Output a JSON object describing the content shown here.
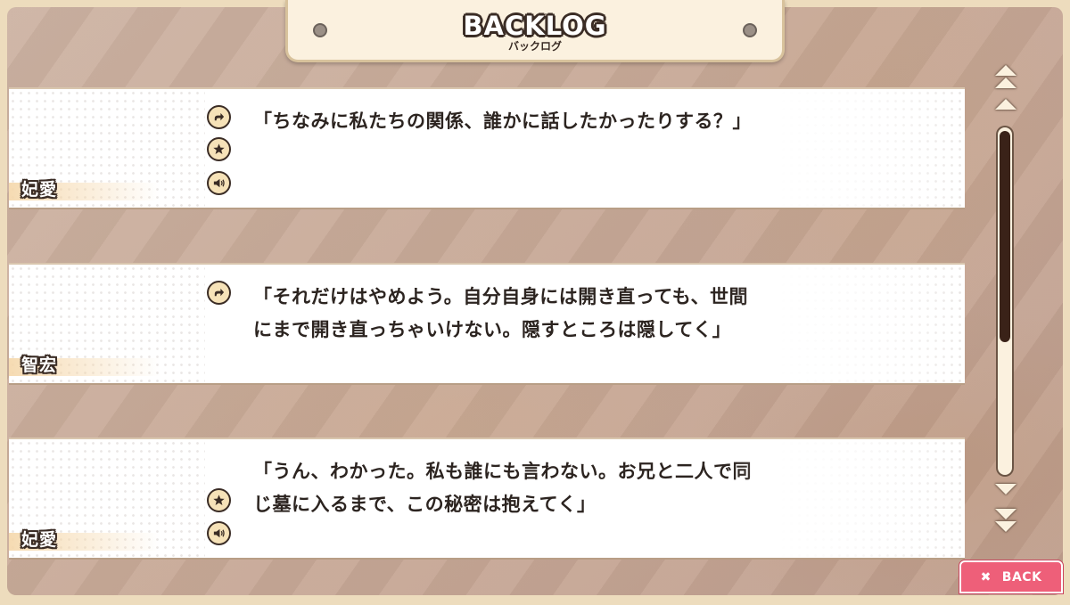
{
  "header": {
    "title": "BACKLOG",
    "subtitle": "バックログ"
  },
  "entries": [
    {
      "speaker": "妃愛",
      "text": "「ちなみに私たちの関係、誰かに話したかったりする？」",
      "icons": [
        "jump-icon",
        "star-icon",
        "voice-icon"
      ]
    },
    {
      "speaker": "智宏",
      "text": "「それだけはやめよう。自分自身には開き直っても、世間\nにまで開き直っちゃいけない。隠すところは隠してく」",
      "icons": [
        "jump-icon"
      ]
    },
    {
      "speaker": "妃愛",
      "text": "「うん、わかった。私も誰にも言わない。お兄と二人で同\nじ墓に入るまで、この秘密は抱えてく」",
      "icons": [
        "star-icon",
        "voice-icon"
      ]
    }
  ],
  "scrollbar": {
    "position_fraction": 0.62
  },
  "back_button": {
    "icon": "close-icon",
    "label": "BACK",
    "color": "#ee5f79"
  },
  "colors": {
    "outline": "#3a2c25",
    "panel": "#fbf1df"
  }
}
